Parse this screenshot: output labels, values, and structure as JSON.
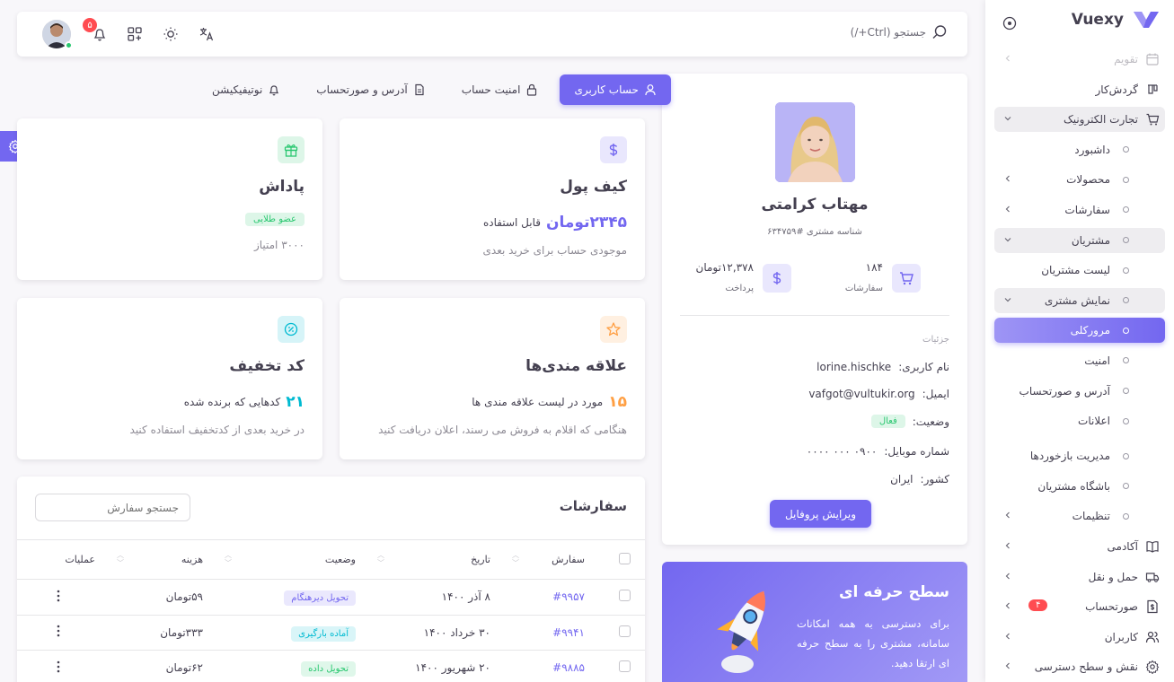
{
  "brand": {
    "name": "Vuexy"
  },
  "navbar": {
    "search_label": "جستجو (Ctrl+/)",
    "notification_count": "۵",
    "background_ghost": "شناسه مشتری ‎#۶۳۴۷۵۹"
  },
  "sidebar": {
    "items": [
      {
        "label": "تقویم",
        "type": "top",
        "faded": true
      },
      {
        "label": "گردش‌کار",
        "type": "top",
        "icon": "kanban-icon"
      },
      {
        "label": "تجارت الکترونیک",
        "type": "top",
        "icon": "cart-icon",
        "state": "open"
      },
      {
        "label": "داشبورد",
        "type": "child"
      },
      {
        "label": "محصولات",
        "type": "child",
        "chevron": true
      },
      {
        "label": "سفارشات",
        "type": "child",
        "chevron": true
      },
      {
        "label": "مشتریان",
        "type": "child",
        "state": "open"
      },
      {
        "label": "لیست مشتریان",
        "type": "grandchild"
      },
      {
        "label": "نمایش مشتری",
        "type": "grandchild",
        "state": "open"
      },
      {
        "label": "مرورکلی",
        "type": "great",
        "state": "active"
      },
      {
        "label": "امنیت",
        "type": "great"
      },
      {
        "label": "آدرس و صورتحساب",
        "type": "great"
      },
      {
        "label": "اعلانات",
        "type": "great"
      },
      {
        "label": "مدیریت بازخوردها",
        "type": "child"
      },
      {
        "label": "باشگاه مشتریان",
        "type": "child"
      },
      {
        "label": "تنظیمات",
        "type": "child",
        "chevron": true
      },
      {
        "label": "آکادمی",
        "type": "top",
        "icon": "book-icon",
        "chevron": true
      },
      {
        "label": "حمل و نقل",
        "type": "top",
        "icon": "truck-icon",
        "chevron": true
      },
      {
        "label": "صورتحساب",
        "type": "top",
        "icon": "invoice-icon",
        "chevron": true,
        "badge": "۴"
      },
      {
        "label": "کاربران",
        "type": "top",
        "icon": "users-icon",
        "chevron": true
      },
      {
        "label": "نقش و سطح دسترسی",
        "type": "top",
        "icon": "settings-icon",
        "chevron": true
      }
    ]
  },
  "tabs": [
    {
      "label": "حساب کاربری",
      "active": true,
      "icon": "user-icon"
    },
    {
      "label": "امنیت حساب",
      "icon": "lock-icon"
    },
    {
      "label": "آدرس و صورتحساب",
      "icon": "file-icon"
    },
    {
      "label": "نوتیفیکیشن",
      "icon": "bell-icon"
    }
  ],
  "profile": {
    "name": "مهتاب کرامتی",
    "customer_id": "شناسه مشتری #۶۳۴۷۵۹",
    "stats": [
      {
        "value": "۱۸۴",
        "label": "سفارشات",
        "icon": "cart-icon"
      },
      {
        "value": "۱۲,۳۷۸تومان",
        "label": "پرداخت",
        "icon": "dollar-icon"
      }
    ],
    "details_title": "جزئیات",
    "details": [
      {
        "key": "نام کاربری:",
        "value": "lorine.hischke"
      },
      {
        "key": "ایمیل:",
        "value": "vafgot@vultukir.org"
      },
      {
        "key": "وضعیت:",
        "value": "فعال",
        "pill": true
      },
      {
        "key": "شماره موبایل:",
        "value": "۰۹۰۰ ۰۰۰ ۰۰۰۰"
      },
      {
        "key": "کشور:",
        "value": "ایران"
      }
    ],
    "edit_button": "ویرایش پروفایل"
  },
  "promo": {
    "title": "سطح حرفه ای",
    "text": "برای دسترسی به همه امکانات سامانه، مشتری را به سطح حرفه ای ارتقا دهید."
  },
  "cards": {
    "wallet": {
      "title": "کیف پول",
      "amount": "۲۳۴۵تومان",
      "amount_suffix": "قابل استفاده",
      "desc": "موجودی حساب برای خرید بعدی",
      "color": "#7367f0"
    },
    "reward": {
      "title": "پاداش",
      "badge": "عضو طلایی",
      "desc": "۳۰۰۰ امتیاز",
      "color": "#28c76f"
    },
    "wishlist": {
      "title": "علاقه مندی‌ها",
      "count": "۱۵",
      "count_suffix": "مورد در لیست علاقه مندی ها",
      "desc": "هنگامی که اقلام به فروش می رسند، اعلان دریافت کنید",
      "color": "#ff9f43"
    },
    "coupon": {
      "title": "کد تخفیف",
      "count": "۲۱",
      "count_suffix": "کدهایی که برنده شده",
      "desc": "در خرید بعدی از کدتخفیف استفاده کنید",
      "color": "#00bad1"
    }
  },
  "orders": {
    "title": "سفارشات",
    "search_placeholder": "جستجو سفارش",
    "columns": [
      "سفارش",
      "تاریخ",
      "وضعیت",
      "هزینه",
      "عملیات"
    ],
    "rows": [
      {
        "id": "#۹۹۵۷",
        "date": "۸ آذر ۱۴۰۰",
        "status": "تحویل دیرهنگام",
        "status_color": "#7367f0",
        "cost": "۵۹تومان"
      },
      {
        "id": "#۹۹۴۱",
        "date": "۳۰ خرداد ۱۴۰۰",
        "status": "آماده بارگیری",
        "status_color": "#00bad1",
        "cost": "۳۳۳تومان"
      },
      {
        "id": "#۹۸۸۵",
        "date": "۲۰ شهریور ۱۴۰۰",
        "status": "تحویل داده",
        "status_color": "#28c76f",
        "cost": "۶۲تومان"
      }
    ]
  }
}
